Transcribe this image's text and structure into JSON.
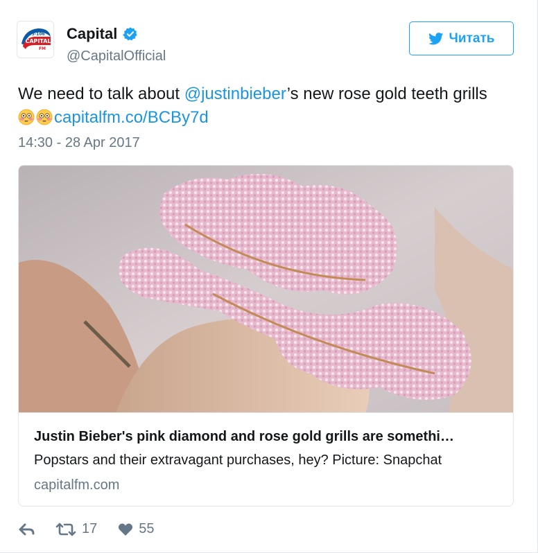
{
  "author": {
    "display_name": "Capital",
    "handle": "@CapitalOfficial",
    "verified": true,
    "avatar_text": "CAPITAL",
    "avatar_subtext": "FM",
    "avatar_freq": "95-106"
  },
  "follow_button": {
    "label": "Читать",
    "icon": "twitter-bird-icon"
  },
  "tweet": {
    "text_before": "We need to talk about ",
    "mention": "@justinbieber",
    "text_after": "’s new rose gold teeth grills",
    "emojis": [
      "flushed-face-emoji",
      "flushed-face-emoji"
    ],
    "link": "capitalfm.co/BCBy7d",
    "timestamp": "14:30 - 28 Apr 2017"
  },
  "card": {
    "title": "Justin Bieber's pink diamond and rose gold grills are somethi…",
    "description": "Popstars and their extravagant purchases, hey? Picture: Snapchat",
    "domain": "capitalfm.com"
  },
  "actions": {
    "reply_icon": "reply-icon",
    "retweet_icon": "retweet-icon",
    "retweet_count": "17",
    "like_icon": "heart-icon",
    "like_count": "55"
  },
  "colors": {
    "accent": "#1da1f2",
    "link": "#1b95e0",
    "secondary_text": "#657786",
    "border": "#e1e8ed",
    "avatar_red": "#d62027",
    "avatar_blue": "#0a5aa8"
  }
}
